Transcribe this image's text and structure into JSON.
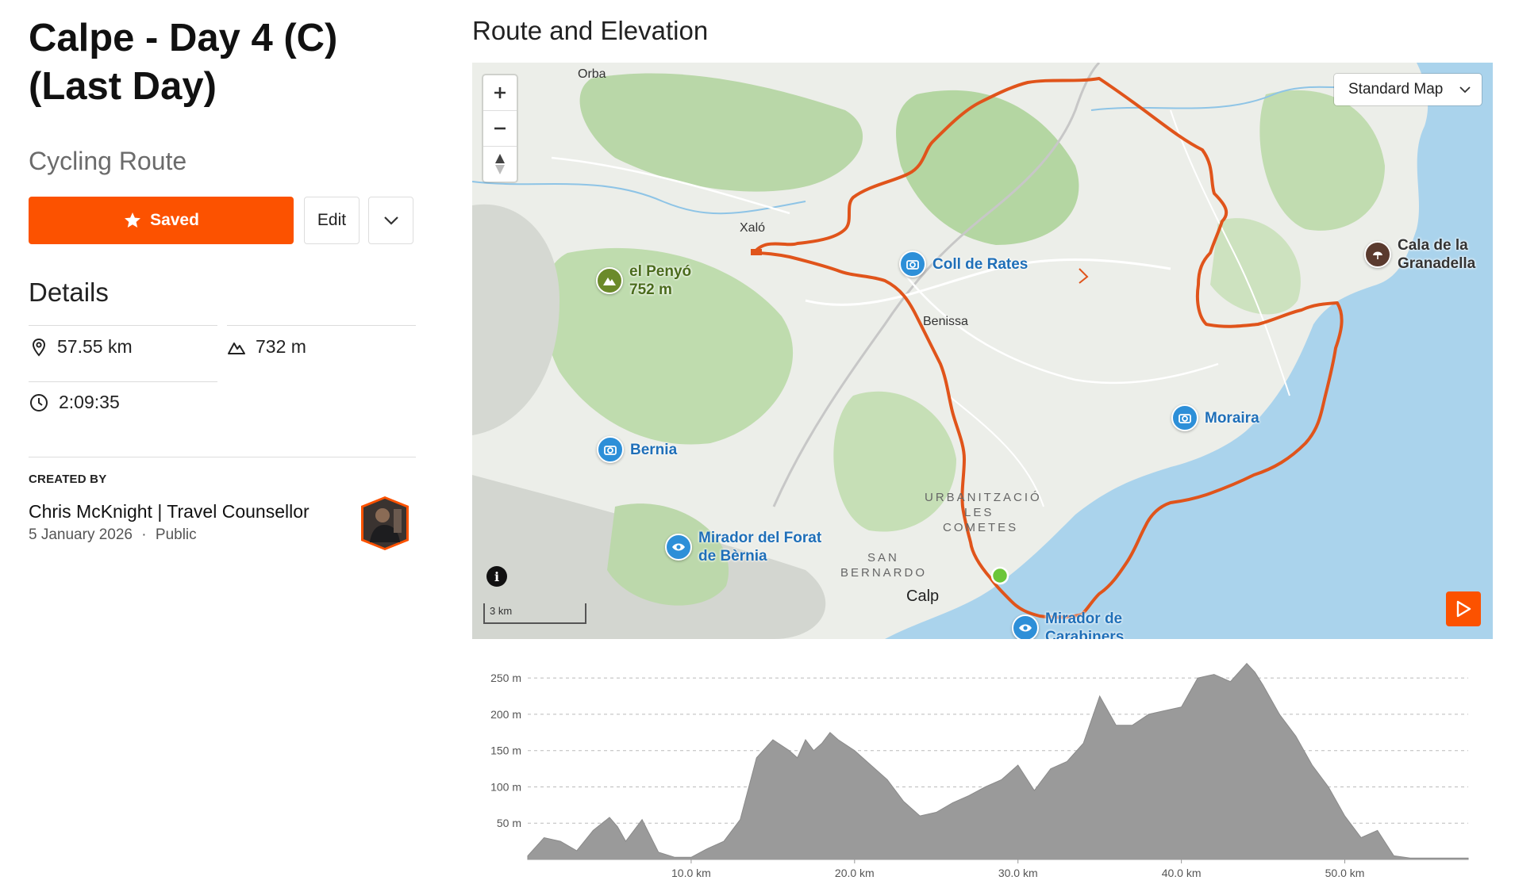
{
  "route": {
    "title": "Calpe - Day 4 (C) (Last Day)",
    "type": "Cycling Route"
  },
  "actions": {
    "saved_label": "Saved",
    "edit_label": "Edit"
  },
  "details": {
    "heading": "Details",
    "distance": "57.55 km",
    "elevation_gain": "732 m",
    "moving_time": "2:09:35"
  },
  "creator": {
    "heading": "CREATED BY",
    "name": "Chris McKnight | Travel Counsellor",
    "date": "5 January 2026",
    "separator": "·",
    "visibility": "Public"
  },
  "map": {
    "section_title": "Route and Elevation",
    "style_selector": "Standard Map",
    "scale_label": "3 km",
    "info_label": "i",
    "places": [
      "Orba",
      "Xaló",
      "Benissa",
      "URBANITZACIÓ",
      "LES",
      "COMETES",
      "SAN",
      "BERNARDO",
      "Calp"
    ],
    "pois": [
      {
        "line1": "el Penyó",
        "line2": "752 m",
        "icon": "mountain-icon"
      },
      {
        "line1": "Coll de Rates",
        "line2": "",
        "icon": "camera-icon"
      },
      {
        "line1": "Cala de la",
        "line2": "Granadella",
        "icon": "beach-icon"
      },
      {
        "line1": "Moraira",
        "line2": "",
        "icon": "camera-icon"
      },
      {
        "line1": "Bernia",
        "line2": "",
        "icon": "camera-icon"
      },
      {
        "line1": "Mirador del Forat",
        "line2": "de Bèrnia",
        "icon": "eye-icon"
      },
      {
        "line1": "Mirador de",
        "line2": "Carabiners",
        "icon": "eye-icon"
      }
    ],
    "colors": {
      "route": "#e0541b",
      "water": "#aad3ec",
      "poi_blue": "#2d8fd8",
      "start": "#6cc63a"
    }
  },
  "chart_data": {
    "type": "area",
    "x": [
      0,
      1,
      2,
      3,
      4,
      5,
      5.5,
      6,
      7,
      8,
      9,
      10,
      11,
      12,
      13,
      14,
      15,
      16,
      16.5,
      17,
      17.5,
      18,
      18.5,
      19,
      20,
      21,
      22,
      23,
      24,
      25,
      26,
      27,
      28,
      29,
      30,
      31,
      31.5,
      32,
      33,
      34,
      35,
      36,
      37,
      38,
      39,
      40,
      41,
      42,
      43,
      44,
      44.5,
      45,
      46,
      47,
      48,
      49,
      50,
      51,
      52,
      53,
      54,
      55,
      56,
      57,
      57.55
    ],
    "values": [
      5,
      30,
      25,
      12,
      40,
      58,
      45,
      25,
      55,
      10,
      3,
      3,
      15,
      25,
      55,
      140,
      165,
      150,
      140,
      165,
      150,
      160,
      175,
      165,
      150,
      130,
      110,
      80,
      60,
      65,
      78,
      88,
      100,
      110,
      130,
      95,
      110,
      125,
      135,
      160,
      225,
      185,
      185,
      200,
      205,
      210,
      250,
      255,
      245,
      270,
      258,
      240,
      200,
      170,
      130,
      100,
      60,
      30,
      40,
      5,
      2,
      2,
      2,
      2,
      2
    ],
    "xlim": [
      0,
      57.55
    ],
    "ylim": [
      0,
      260
    ],
    "x_ticks": [
      10,
      20,
      30,
      40,
      50
    ],
    "x_tick_labels": [
      "10.0 km",
      "20.0 km",
      "30.0 km",
      "40.0 km",
      "50.0 km"
    ],
    "y_ticks": [
      50,
      100,
      150,
      200,
      250
    ],
    "y_tick_labels": [
      "50 m",
      "100 m",
      "150 m",
      "200 m",
      "250 m"
    ],
    "grid": true,
    "fill_color": "#9a9a9a"
  }
}
